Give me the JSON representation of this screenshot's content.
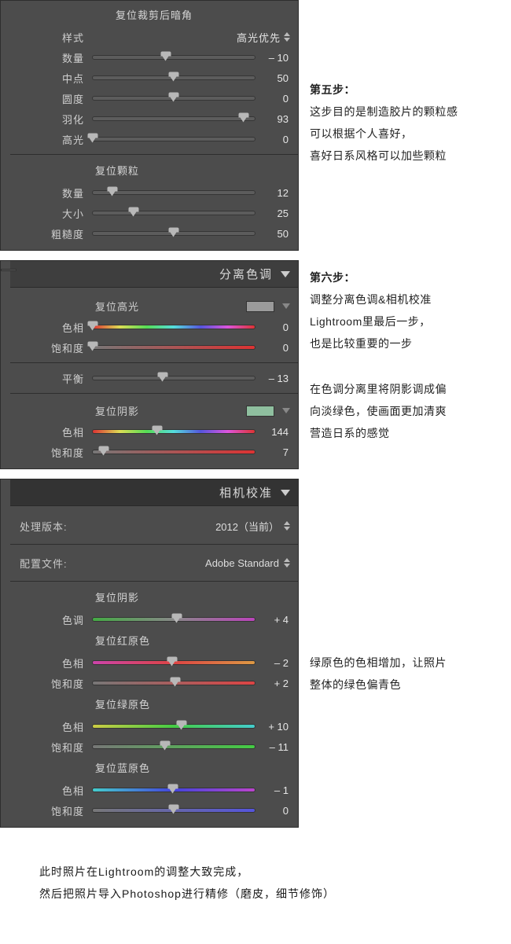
{
  "step5": {
    "heading": "第五步：",
    "lines": [
      "这步目的是制造胶片的颗粒感",
      "可以根据个人喜好，",
      "喜好日系风格可以加些颗粒"
    ]
  },
  "step6": {
    "heading": "第六步：",
    "lines": [
      "调整分离色调&相机校准",
      "Lightroom里最后一步，",
      "也是比较重要的一步"
    ]
  },
  "note_split": [
    "在色调分离里将阴影调成偏",
    "向淡绿色，使画面更加清爽",
    "营造日系的感觉"
  ],
  "note_green": [
    "绿原色的色相增加，让照片",
    "整体的绿色偏青色"
  ],
  "footer": [
    "此时照片在Lightroom的调整大致完成，",
    "然后把照片导入Photoshop进行精修（磨皮，细节修饰）"
  ],
  "vignette": {
    "title": "复位裁剪后暗角",
    "style_label": "样式",
    "style_value": "高光优先",
    "sliders": [
      {
        "label": "数量",
        "value": "– 10",
        "pos": 45
      },
      {
        "label": "中点",
        "value": "50",
        "pos": 50
      },
      {
        "label": "圆度",
        "value": "0",
        "pos": 50
      },
      {
        "label": "羽化",
        "value": "93",
        "pos": 93
      },
      {
        "label": "高光",
        "value": "0",
        "pos": 0
      }
    ]
  },
  "grain": {
    "title": "复位颗粒",
    "sliders": [
      {
        "label": "数量",
        "value": "12",
        "pos": 12
      },
      {
        "label": "大小",
        "value": "25",
        "pos": 25
      },
      {
        "label": "粗糙度",
        "value": "50",
        "pos": 50
      }
    ]
  },
  "split_toning": {
    "panel_title": "分离色调",
    "highlights_title": "复位高光",
    "highlights": {
      "hue": {
        "label": "色相",
        "value": "0",
        "pos": 0
      },
      "saturation": {
        "label": "饱和度",
        "value": "0",
        "pos": 0
      }
    },
    "balance": {
      "label": "平衡",
      "value": "– 13",
      "pos": 43
    },
    "shadows_title": "复位阴影",
    "shadows": {
      "hue": {
        "label": "色相",
        "value": "144",
        "pos": 40
      },
      "saturation": {
        "label": "饱和度",
        "value": "7",
        "pos": 7
      }
    }
  },
  "camera_calibration": {
    "panel_title": "相机校准",
    "process_label": "处理版本:",
    "process_value": "2012（当前）",
    "profile_label": "配置文件:",
    "profile_value": "Adobe Standard",
    "shadows_title": "复位阴影",
    "shadows_tint": {
      "label": "色调",
      "value": "+ 4",
      "pos": 52
    },
    "red_title": "复位红原色",
    "red": {
      "hue": {
        "label": "色相",
        "value": "– 2",
        "pos": 49
      },
      "sat": {
        "label": "饱和度",
        "value": "+ 2",
        "pos": 51
      }
    },
    "green_title": "复位绿原色",
    "green": {
      "hue": {
        "label": "色相",
        "value": "+ 10",
        "pos": 55
      },
      "sat": {
        "label": "饱和度",
        "value": "– 11",
        "pos": 44.5
      }
    },
    "blue_title": "复位蓝原色",
    "blue": {
      "hue": {
        "label": "色相",
        "value": "– 1",
        "pos": 49.5
      },
      "sat": {
        "label": "饱和度",
        "value": "0",
        "pos": 50
      }
    }
  }
}
